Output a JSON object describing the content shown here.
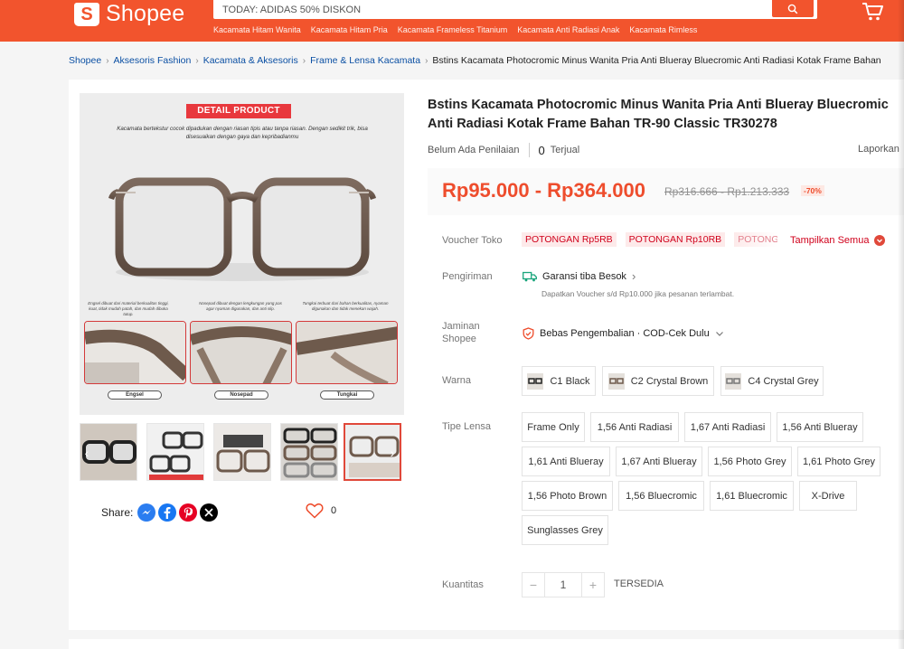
{
  "header": {
    "logo_text": "Shopee",
    "logo_glyph": "S",
    "search_placeholder": "TODAY: ADIDAS 50% DISKON",
    "suggestions": [
      "Kacamata Hitam Wanita",
      "Kacamata Hitam Pria",
      "Kacamata Frameless Titanium",
      "Kacamata Anti Radiasi Anak",
      "Kacamata Rimless"
    ],
    "brand_color": "#f2542d"
  },
  "breadcrumb": {
    "items": [
      "Shopee",
      "Aksesoris Fashion",
      "Kacamata & Aksesoris",
      "Frame & Lensa Kacamata"
    ],
    "current": "Bstins Kacamata Photocromic Minus Wanita Pria Anti Blueray Bluecromic Anti Radiasi Kotak Frame Bahan"
  },
  "gallery": {
    "badge_prefix": "DETAIL ",
    "badge_text": "PRODUCT",
    "description": "Kacamata bertekstur cocok dipadukan dengan riasan tipis atau tanpa riasan. Dengan sedikit trik, bisa disesuaikan dengan gaya dan kepribadianmu",
    "captions": [
      "Engsel dibuat dari material berkualitas tinggi, kuat, tidak mudah patah, dan mudah dibuka tutup.",
      "Nosepad dibuat dengan lengkungan yang pas agar nyaman digunakan, dan anti slip.",
      "Tungkai terbuat dari bahan berkualitas, nyaman digunakan dan tidak menekan wajah."
    ],
    "zoom_labels": [
      "Engsel",
      "Nosepad",
      "Tungkai"
    ],
    "thumbnail_count": 5,
    "active_thumbnail": 5,
    "prev_glyph": "‹",
    "next_glyph": "›"
  },
  "share": {
    "label": "Share:",
    "networks": [
      "messenger-icon",
      "facebook-icon",
      "pinterest-icon",
      "x-icon"
    ],
    "likes": "0"
  },
  "product": {
    "title": "Bstins Kacamata Photocromic Minus Wanita Pria Anti Blueray Bluecromic Anti Radiasi Kotak Frame Bahan TR-90 Classic TR30278",
    "rating_text": "Belum Ada Penilaian",
    "sold_count": "0",
    "sold_label": "Terjual",
    "report_label": "Laporkan",
    "price": "Rp95.000 - Rp364.000",
    "price_original": "Rp316.666 - Rp1.213.333",
    "discount": "-70%",
    "accent_color": "#ee4d2d"
  },
  "voucher": {
    "label": "Voucher Toko",
    "items": [
      "POTONGAN Rp5RB",
      "POTONGAN Rp10RB",
      "POTONGAN"
    ],
    "show_all": "Tampilkan Semua"
  },
  "shipping": {
    "label": "Pengiriman",
    "headline": "Garansi tiba Besok",
    "sub": "Dapatkan Voucher s/d Rp10.000 jika pesanan terlambat."
  },
  "guarantee": {
    "label": "Jaminan Shopee",
    "text": "Bebas Pengembalian · COD-Cek Dulu"
  },
  "color_option": {
    "label": "Warna",
    "options": [
      "C1 Black",
      "C2 Crystal Brown",
      "C4 Crystal Grey"
    ]
  },
  "lens_option": {
    "label": "Tipe Lensa",
    "options": [
      "Frame Only",
      "1,56 Anti Radiasi",
      "1,67 Anti Radiasi",
      "1,56 Anti Blueray",
      "1,61 Anti Blueray",
      "1,67 Anti Blueray",
      "1,56 Photo Grey",
      "1,61 Photo Grey",
      "1,56 Photo Brown",
      "1,56 Bluecromic",
      "1,61 Bluecromic",
      "X-Drive",
      "Sunglasses Grey"
    ]
  },
  "quantity": {
    "label": "Kuantitas",
    "value": "1",
    "minus": "−",
    "plus": "+",
    "stock_label": "TERSEDIA"
  }
}
